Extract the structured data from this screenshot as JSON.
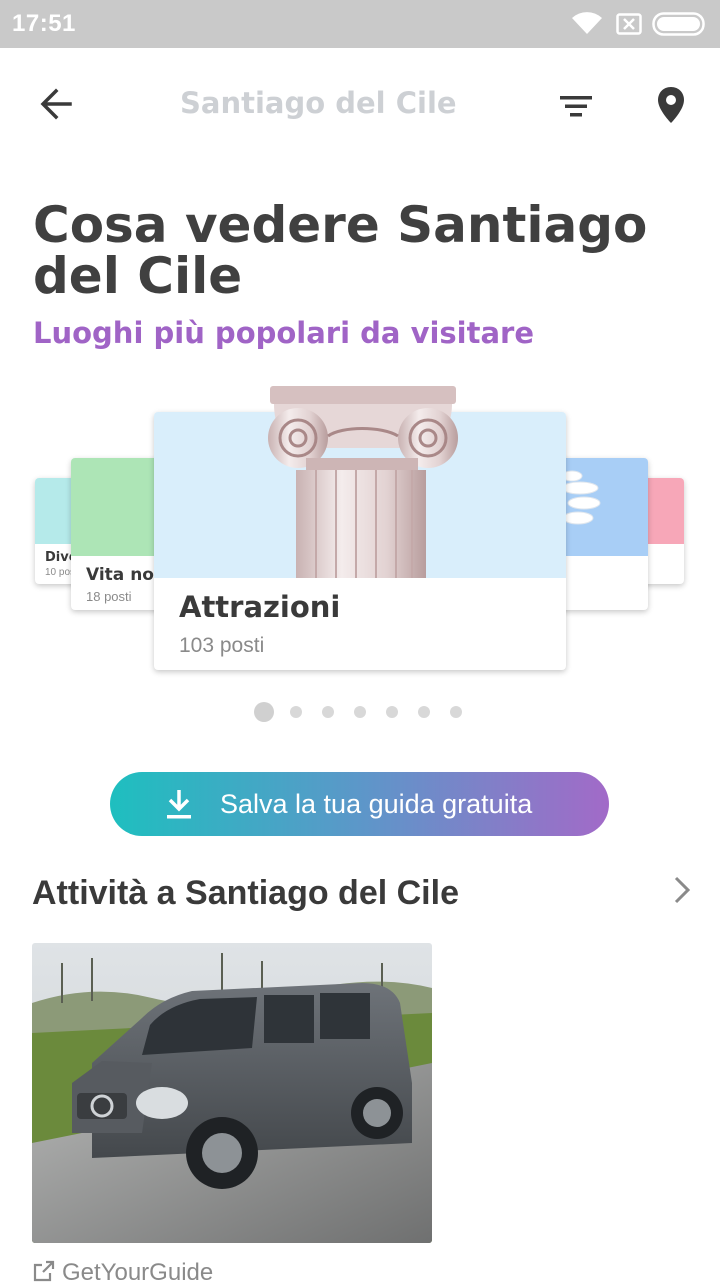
{
  "status_bar": {
    "time": "17:51"
  },
  "app_bar": {
    "title": "Santiago del Cile"
  },
  "header": {
    "title": "Cosa vedere Santiago del Cile",
    "subtitle": "Luoghi più popolari da visitare"
  },
  "carousel": {
    "cards": [
      {
        "title": "Dive",
        "count": "10 posti"
      },
      {
        "title": "Vita no",
        "count": "18 posti"
      },
      {
        "title": "Attrazioni",
        "count": "103 posti"
      }
    ],
    "page_count": 7,
    "active_index": 0
  },
  "cta": {
    "label": "Salva la tua guida gratuita"
  },
  "activities": {
    "title": "Attività a Santiago del Cile",
    "provider": "GetYourGuide"
  },
  "colors": {
    "accent_purple": "#a064c6",
    "cta_start": "#1ebfbf",
    "cta_end": "#a26ac8",
    "status_bar": "#c9c9c9"
  }
}
